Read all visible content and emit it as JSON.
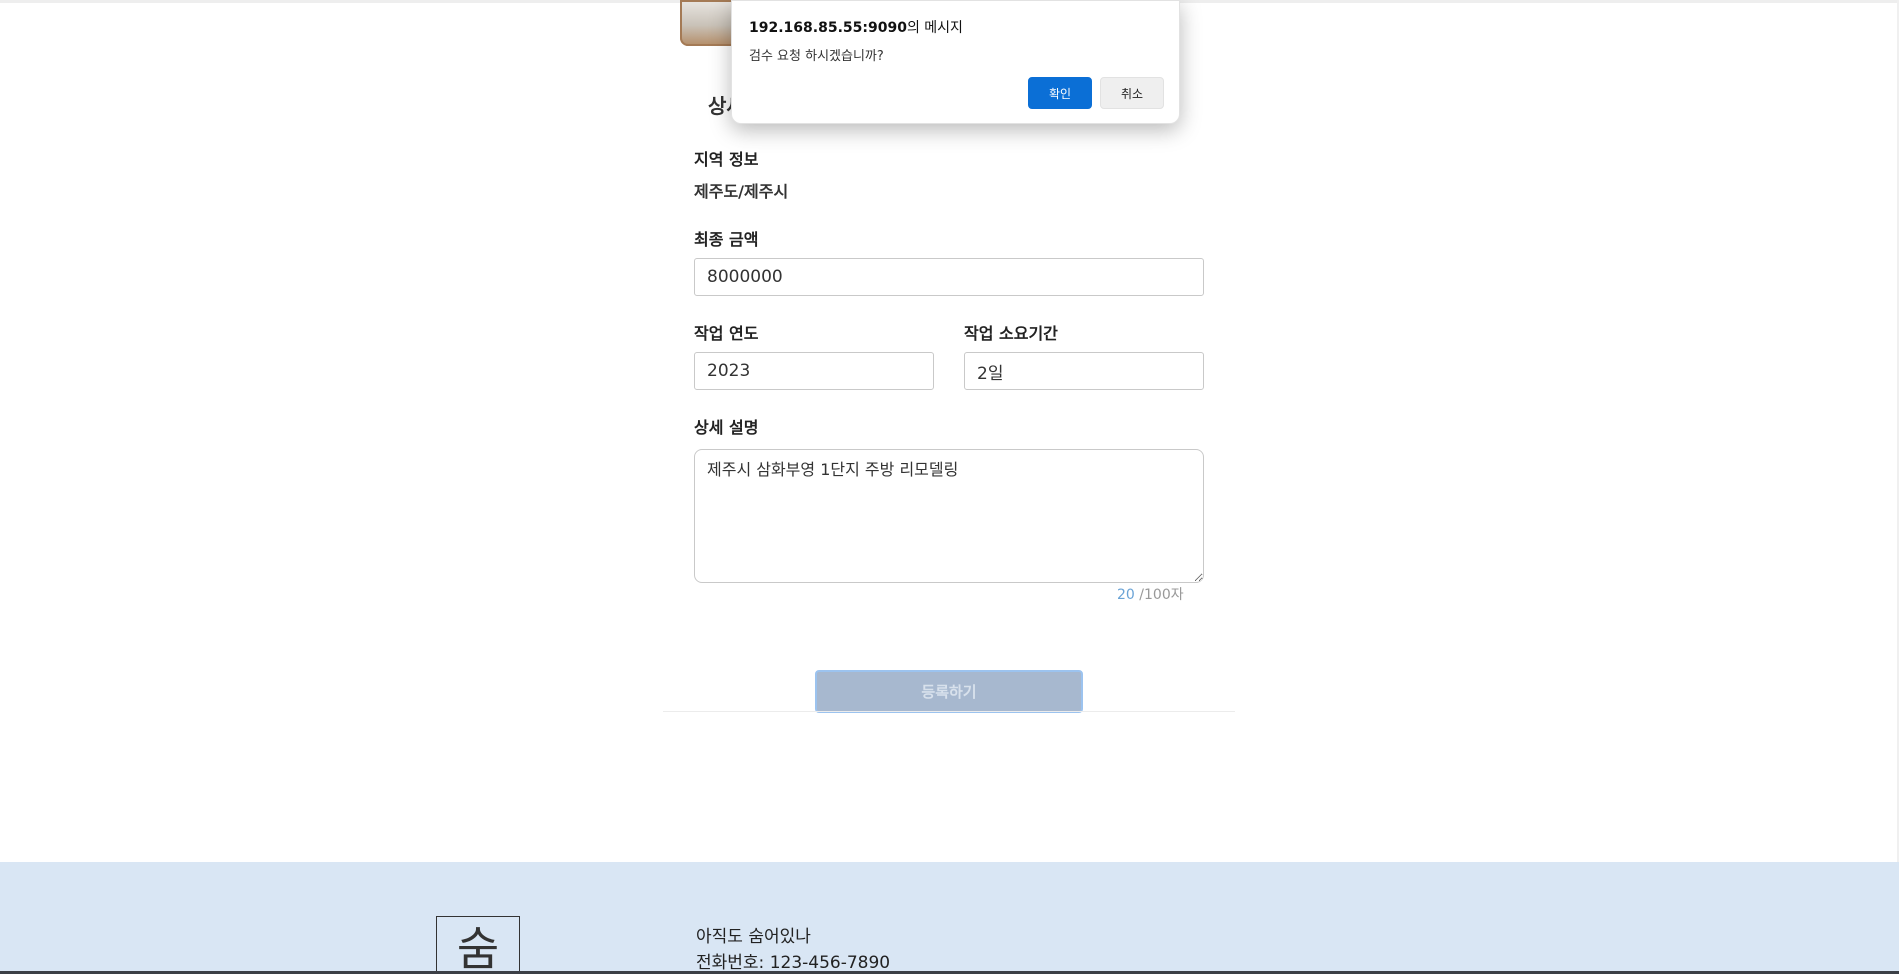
{
  "form": {
    "section_title": "상세",
    "region": {
      "label": "지역 정보",
      "value": "제주도/제주시"
    },
    "final_amount": {
      "label": "최종 금액",
      "value": "8000000"
    },
    "work_year": {
      "label": "작업 연도",
      "value": "2023"
    },
    "work_duration": {
      "label": "작업 소요기간",
      "value": "2일"
    },
    "description": {
      "label": "상세 설명",
      "value": "제주시 삼화부영 1단지 주방 리모델링",
      "char_count": "20",
      "char_limit": "/100자"
    },
    "submit_label": "등록하기"
  },
  "footer": {
    "logo_text": "숨",
    "tagline": "아직도 숨어있나",
    "phone": "전화번호: 123-456-7890"
  },
  "dialog": {
    "origin": "192.168.85.55:9090",
    "title_suffix": "의 메시지",
    "message": "검수 요청 하시겠습니까?",
    "ok_label": "확인",
    "cancel_label": "취소"
  },
  "colors": {
    "footer_background": "#d9e6f4",
    "dialog_ok": "#0b6fd6",
    "submit_disabled": "#a7b8cf",
    "counter_accent": "#6aa3d6"
  }
}
